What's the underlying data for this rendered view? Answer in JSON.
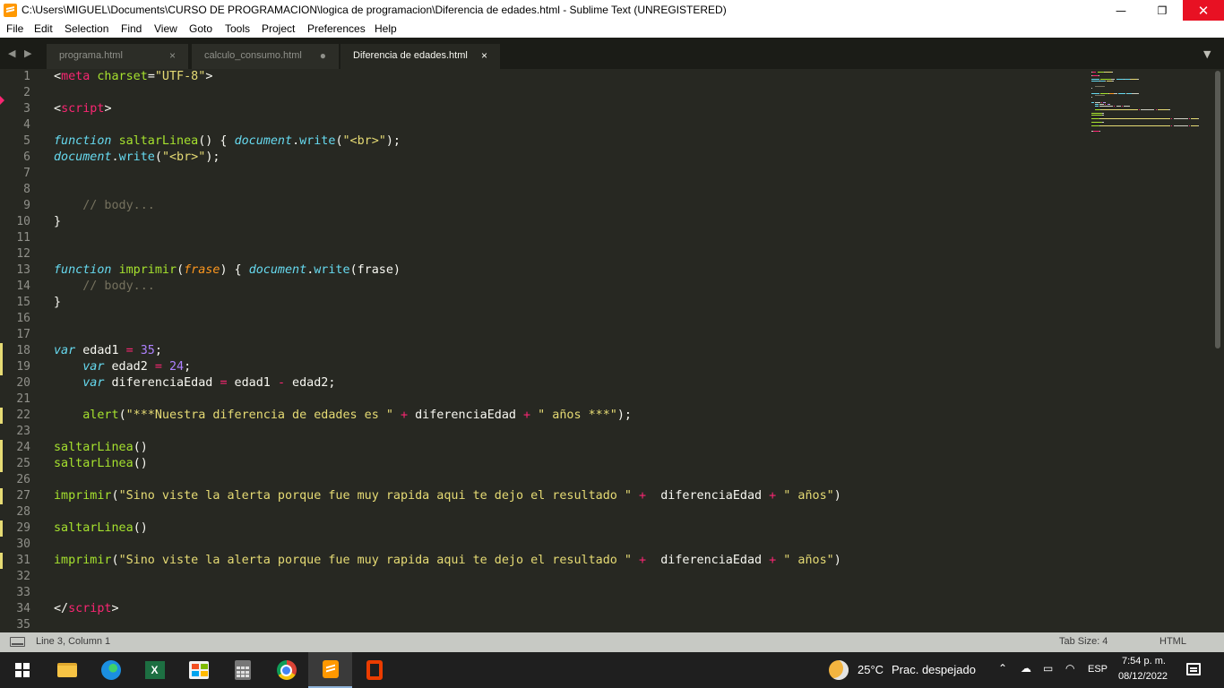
{
  "window": {
    "title": "C:\\Users\\MIGUEL\\Documents\\CURSO DE PROGRAMACION\\logica de programacion\\Diferencia de edades.html - Sublime Text (UNREGISTERED)",
    "minimize_glyph": "—",
    "restore_glyph": "❐",
    "close_glyph": "✕"
  },
  "menu": [
    "File",
    "Edit",
    "Selection",
    "Find",
    "View",
    "Goto",
    "Tools",
    "Project",
    "Preferences",
    "Help"
  ],
  "tabs": [
    {
      "label": "programa.html",
      "close": "×",
      "active": false
    },
    {
      "label": "calculo_consumo.html",
      "close": "●",
      "active": false
    },
    {
      "label": "Diferencia de edades.html",
      "close": "×",
      "active": true
    }
  ],
  "nav_arrows": "◀ ▶",
  "tab_menu_arrow": "▼",
  "editor": {
    "line_numbers": [
      "1",
      "2",
      "3",
      "4",
      "5",
      "6",
      "7",
      "8",
      "9",
      "10",
      "11",
      "12",
      "13",
      "14",
      "15",
      "16",
      "17",
      "18",
      "19",
      "20",
      "21",
      "22",
      "23",
      "24",
      "25",
      "26",
      "27",
      "28",
      "29",
      "30",
      "31",
      "32",
      "33",
      "34",
      "35"
    ],
    "modified_lines": [
      18,
      19,
      22,
      24,
      25,
      27,
      29,
      31
    ],
    "lines": [
      [
        [
          "p",
          "<"
        ],
        [
          "tag",
          "meta"
        ],
        [
          "p",
          " "
        ],
        [
          "at",
          "charset"
        ],
        [
          "p",
          "="
        ],
        [
          "str",
          "\"UTF-8\""
        ],
        [
          "p",
          ">"
        ]
      ],
      [],
      [
        [
          "p",
          "<"
        ],
        [
          "tag",
          "script"
        ],
        [
          "p",
          ">"
        ]
      ],
      [],
      [
        [
          "kw",
          "function"
        ],
        [
          "p",
          " "
        ],
        [
          "fn",
          "saltarLinea"
        ],
        [
          "p",
          "() { "
        ],
        [
          "lib",
          "document"
        ],
        [
          "p",
          "."
        ],
        [
          "mth",
          "write"
        ],
        [
          "p",
          "("
        ],
        [
          "str",
          "\"<br>\""
        ],
        [
          "p",
          ");"
        ]
      ],
      [
        [
          "lib",
          "document"
        ],
        [
          "p",
          "."
        ],
        [
          "mth",
          "write"
        ],
        [
          "p",
          "("
        ],
        [
          "str",
          "\"<br>\""
        ],
        [
          "p",
          ");"
        ]
      ],
      [],
      [],
      [
        [
          "p",
          "    "
        ],
        [
          "cm",
          "// body..."
        ]
      ],
      [
        [
          "p",
          "}"
        ]
      ],
      [],
      [],
      [
        [
          "kw",
          "function"
        ],
        [
          "p",
          " "
        ],
        [
          "fn",
          "imprimir"
        ],
        [
          "p",
          "("
        ],
        [
          "prm",
          "frase"
        ],
        [
          "p",
          ") { "
        ],
        [
          "lib",
          "document"
        ],
        [
          "p",
          "."
        ],
        [
          "mth",
          "write"
        ],
        [
          "p",
          "(frase)"
        ]
      ],
      [
        [
          "p",
          "    "
        ],
        [
          "cm",
          "// body..."
        ]
      ],
      [
        [
          "p",
          "}"
        ]
      ],
      [],
      [],
      [
        [
          "kw",
          "var"
        ],
        [
          "p",
          " edad1 "
        ],
        [
          "op",
          "="
        ],
        [
          "p",
          " "
        ],
        [
          "num",
          "35"
        ],
        [
          "p",
          ";"
        ]
      ],
      [
        [
          "p",
          "    "
        ],
        [
          "kw",
          "var"
        ],
        [
          "p",
          " edad2 "
        ],
        [
          "op",
          "="
        ],
        [
          "p",
          " "
        ],
        [
          "num",
          "24"
        ],
        [
          "p",
          ";"
        ]
      ],
      [
        [
          "p",
          "    "
        ],
        [
          "kw",
          "var"
        ],
        [
          "p",
          " diferenciaEdad "
        ],
        [
          "op",
          "="
        ],
        [
          "p",
          " edad1 "
        ],
        [
          "op",
          "-"
        ],
        [
          "p",
          " edad2;"
        ]
      ],
      [],
      [
        [
          "p",
          "    "
        ],
        [
          "fn",
          "alert"
        ],
        [
          "p",
          "("
        ],
        [
          "str",
          "\"***Nuestra diferencia de edades es \""
        ],
        [
          "p",
          " "
        ],
        [
          "op",
          "+"
        ],
        [
          "p",
          " diferenciaEdad "
        ],
        [
          "op",
          "+"
        ],
        [
          "p",
          " "
        ],
        [
          "str",
          "\" años ***\""
        ],
        [
          "p",
          ");"
        ]
      ],
      [],
      [
        [
          "fn",
          "saltarLinea"
        ],
        [
          "p",
          "()"
        ]
      ],
      [
        [
          "fn",
          "saltarLinea"
        ],
        [
          "p",
          "()"
        ]
      ],
      [],
      [
        [
          "fn",
          "imprimir"
        ],
        [
          "p",
          "("
        ],
        [
          "str",
          "\"Sino viste la alerta porque fue muy rapida aqui te dejo el resultado \""
        ],
        [
          "p",
          " "
        ],
        [
          "op",
          "+"
        ],
        [
          "p",
          "  diferenciaEdad "
        ],
        [
          "op",
          "+"
        ],
        [
          "p",
          " "
        ],
        [
          "str",
          "\" años\""
        ],
        [
          "p",
          ")"
        ]
      ],
      [],
      [
        [
          "fn",
          "saltarLinea"
        ],
        [
          "p",
          "()"
        ]
      ],
      [],
      [
        [
          "fn",
          "imprimir"
        ],
        [
          "p",
          "("
        ],
        [
          "str",
          "\"Sino viste la alerta porque fue muy rapida aqui te dejo el resultado \""
        ],
        [
          "p",
          " "
        ],
        [
          "op",
          "+"
        ],
        [
          "p",
          "  diferenciaEdad "
        ],
        [
          "op",
          "+"
        ],
        [
          "p",
          " "
        ],
        [
          "str",
          "\" años\""
        ],
        [
          "p",
          ")"
        ]
      ],
      [],
      [],
      [
        [
          "p",
          "</"
        ],
        [
          "tag",
          "script"
        ],
        [
          "p",
          ">"
        ]
      ],
      []
    ]
  },
  "status": {
    "position": "Line 3, Column 1",
    "tab_size": "Tab Size: 4",
    "syntax": "HTML"
  },
  "taskbar": {
    "apps": [
      "start-button",
      "file-explorer",
      "edge",
      "excel",
      "microsoft-store",
      "calculator",
      "chrome",
      "sublime-text",
      "office"
    ],
    "active_app": "sublime-text",
    "excel_letter": "X",
    "weather_temp": "25°C",
    "weather_desc": "Prac. despejado",
    "language": "ESP",
    "time": "7:54 p. m.",
    "date": "08/12/2022",
    "tray_icons": [
      "chevron-up-icon",
      "onedrive-icon",
      "battery-icon",
      "wifi-icon"
    ]
  },
  "colors": {
    "editor_bg": "#272822",
    "tab_bar_bg": "#1b1c17",
    "status_bar_bg": "#c7c9c4",
    "taskbar_bg": "#1f1f1f",
    "close_button_bg": "#e81123",
    "accent_modified": "#e6db74"
  }
}
